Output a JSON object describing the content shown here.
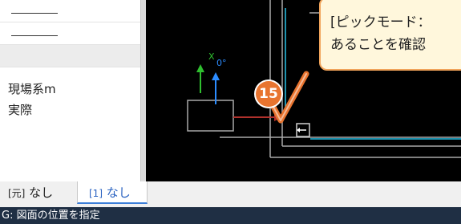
{
  "panel": {
    "rows": [
      {
        "label": ""
      },
      {
        "label": ""
      },
      {
        "label": ""
      },
      {
        "label": "現場系m"
      },
      {
        "label": "実際"
      }
    ]
  },
  "canvas": {
    "axis_label": "X",
    "angle_label": "0°",
    "step_number": "15"
  },
  "callout": {
    "line1": "[ピックモード：",
    "line2": "あることを確認"
  },
  "tabs": {
    "model_prefix": "[元]",
    "model_label": "なし",
    "layout_prefix": "[1]",
    "layout_label": "なし"
  },
  "status": {
    "text": "G: 図面の位置を指定"
  },
  "colors": {
    "accent": "#e8742f",
    "axis_green": "#2fbf2f",
    "axis_blue": "#2c8cff",
    "cyan": "#29c2e8"
  }
}
